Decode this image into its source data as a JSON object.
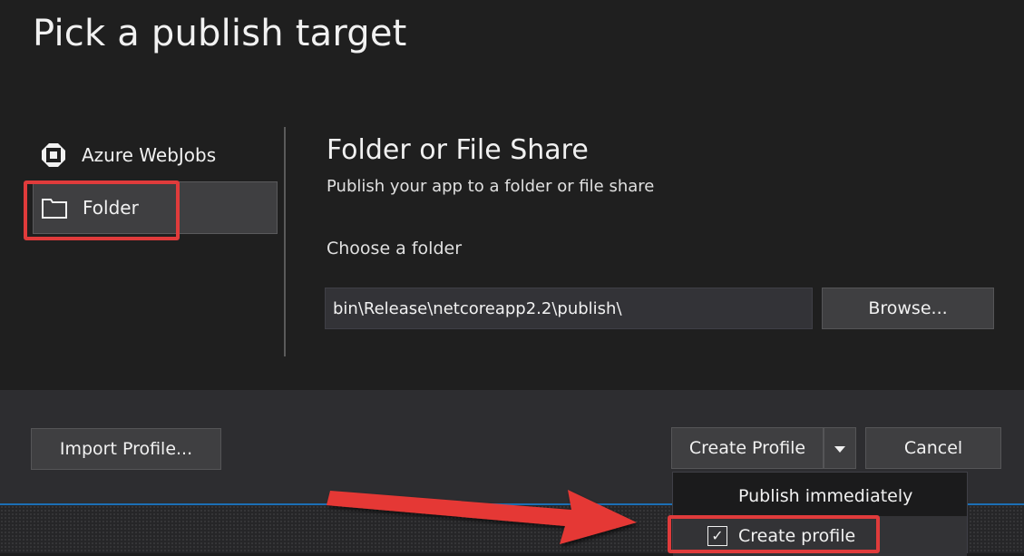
{
  "dialog": {
    "title": "Pick a publish target"
  },
  "sidebar": {
    "items": [
      {
        "label": "Azure WebJobs",
        "icon": "azure-webjobs-icon"
      },
      {
        "label": "Folder",
        "icon": "folder-icon",
        "selected": true
      }
    ]
  },
  "content": {
    "title": "Folder or File Share",
    "subtitle": "Publish your app to a folder or file share",
    "choose_label": "Choose a folder",
    "folder_path": "bin\\Release\\netcoreapp2.2\\publish\\",
    "browse_label": "Browse..."
  },
  "footer": {
    "import_label": "Import Profile...",
    "create_label": "Create Profile",
    "cancel_label": "Cancel"
  },
  "dropdown": {
    "items": [
      {
        "label": "Publish immediately",
        "checked": false
      },
      {
        "label": "Create profile",
        "checked": true
      }
    ]
  },
  "colors": {
    "background": "#1f1f1f",
    "footer_background": "#2d2d30",
    "highlight": "#e03b3b",
    "accent_line": "#1c6fb5"
  }
}
